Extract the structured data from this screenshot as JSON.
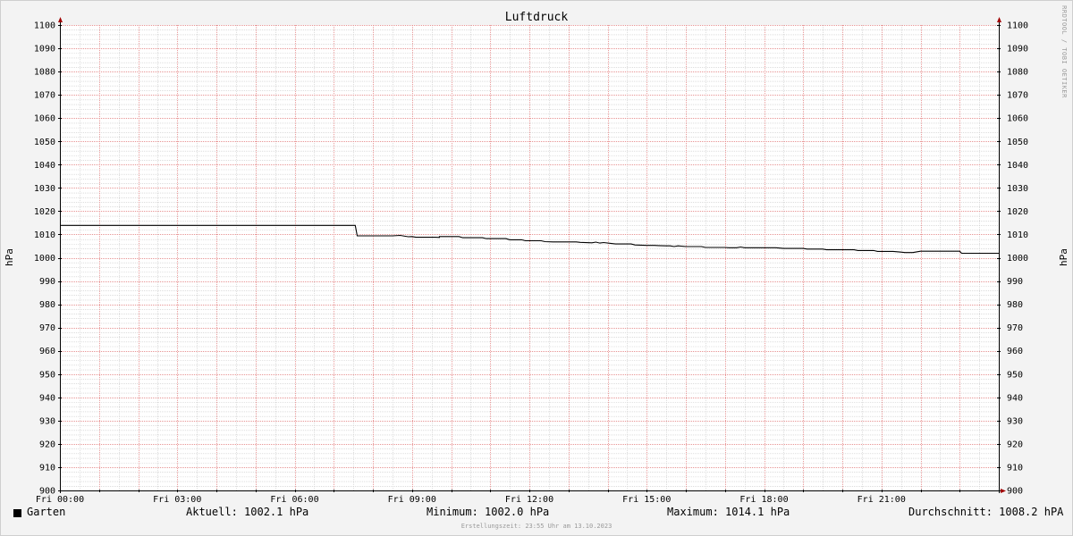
{
  "chart_data": {
    "type": "line",
    "title": "Luftdruck",
    "ylabel": "hPa",
    "ylim": [
      900,
      1100
    ],
    "y_ticks": [
      900,
      910,
      920,
      930,
      940,
      950,
      960,
      970,
      980,
      990,
      1000,
      1010,
      1020,
      1030,
      1040,
      1050,
      1060,
      1070,
      1080,
      1090,
      1100
    ],
    "xlim": [
      0,
      24
    ],
    "x_tick_hours": [
      0,
      3,
      6,
      9,
      12,
      15,
      18,
      21
    ],
    "x_tick_labels": [
      "Fri 00:00",
      "Fri 03:00",
      "Fri 06:00",
      "Fri 09:00",
      "Fri 12:00",
      "Fri 15:00",
      "Fri 18:00",
      "Fri 21:00"
    ],
    "grid": true,
    "series": [
      {
        "name": "Garten",
        "color": "#000000",
        "points": [
          [
            0.0,
            1014.1
          ],
          [
            7.55,
            1014.1
          ],
          [
            7.6,
            1009.6
          ],
          [
            8.5,
            1009.6
          ],
          [
            8.7,
            1009.8
          ],
          [
            8.9,
            1009.2
          ],
          [
            9.0,
            1009.3
          ],
          [
            9.1,
            1009.0
          ],
          [
            9.6,
            1009.0
          ],
          [
            9.7,
            1008.9
          ],
          [
            9.7,
            1009.3
          ],
          [
            10.2,
            1009.3
          ],
          [
            10.3,
            1008.8
          ],
          [
            10.8,
            1008.8
          ],
          [
            10.9,
            1008.4
          ],
          [
            11.4,
            1008.4
          ],
          [
            11.5,
            1007.9
          ],
          [
            11.8,
            1007.9
          ],
          [
            11.9,
            1007.5
          ],
          [
            12.3,
            1007.5
          ],
          [
            12.4,
            1007.1
          ],
          [
            12.6,
            1007.0
          ],
          [
            13.2,
            1007.0
          ],
          [
            13.3,
            1006.8
          ],
          [
            13.6,
            1006.6
          ],
          [
            13.7,
            1006.9
          ],
          [
            13.8,
            1006.5
          ],
          [
            13.9,
            1006.7
          ],
          [
            14.1,
            1006.3
          ],
          [
            14.2,
            1006.1
          ],
          [
            14.6,
            1006.1
          ],
          [
            14.7,
            1005.7
          ],
          [
            15.0,
            1005.5
          ],
          [
            15.2,
            1005.5
          ],
          [
            15.3,
            1005.4
          ],
          [
            15.5,
            1005.3
          ],
          [
            15.6,
            1005.3
          ],
          [
            15.7,
            1005.0
          ],
          [
            15.8,
            1005.3
          ],
          [
            16.0,
            1005.0
          ],
          [
            16.4,
            1005.0
          ],
          [
            16.5,
            1004.6
          ],
          [
            17.0,
            1004.6
          ],
          [
            17.1,
            1004.5
          ],
          [
            17.3,
            1004.5
          ],
          [
            17.4,
            1004.8
          ],
          [
            17.5,
            1004.5
          ],
          [
            18.3,
            1004.5
          ],
          [
            18.5,
            1004.2
          ],
          [
            19.0,
            1004.2
          ],
          [
            19.1,
            1003.9
          ],
          [
            19.5,
            1003.9
          ],
          [
            19.6,
            1003.6
          ],
          [
            20.3,
            1003.6
          ],
          [
            20.4,
            1003.3
          ],
          [
            20.8,
            1003.3
          ],
          [
            20.9,
            1002.9
          ],
          [
            21.3,
            1002.9
          ],
          [
            21.5,
            1002.6
          ],
          [
            21.6,
            1002.4
          ],
          [
            21.8,
            1002.4
          ],
          [
            22.0,
            1003.0
          ],
          [
            23.0,
            1003.0
          ],
          [
            23.05,
            1002.1
          ],
          [
            24.0,
            1002.1
          ]
        ]
      }
    ],
    "colors": {
      "background": "#f3f3f3",
      "plot_background": "#ffffff",
      "minor_grid": "#c8c8c8",
      "major_grid": "#e07070",
      "axis": "#000000",
      "arrow": "#a00000"
    }
  },
  "watermark": "RRDTOOL / TOBI OETIKER",
  "legend": {
    "series_name": "Garten",
    "current": "Aktuell: 1002.1 hPa",
    "minimum": "Minimum: 1002.0 hPa",
    "maximum": "Maximum: 1014.1 hPa",
    "average": "Durchschnitt: 1008.2 hPA"
  },
  "footer": "Erstellungszeit: 23:55 Uhr am 13.10.2023"
}
